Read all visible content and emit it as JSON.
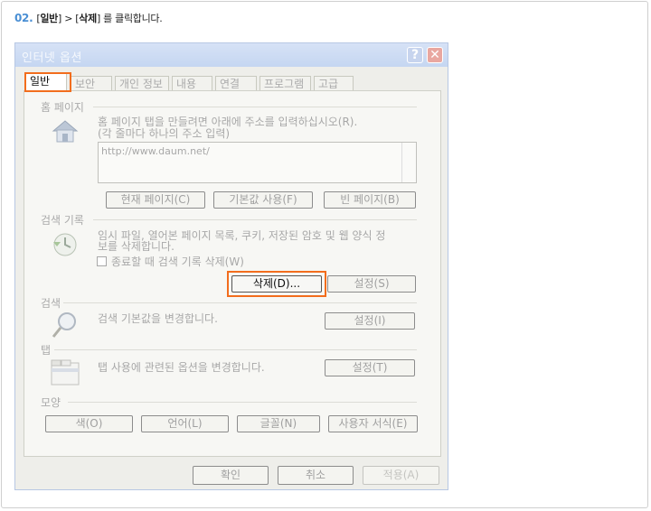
{
  "step": {
    "number": "02.",
    "text_pre": "[",
    "bold1": "일반",
    "text_mid": "] > [",
    "bold2": "삭제",
    "text_post": "] 를 클릭합니다."
  },
  "dialog": {
    "title": "인터넷 옵션",
    "help_glyph": "?",
    "close_glyph": "✕",
    "tabs": [
      "일반",
      "보안",
      "개인 정보",
      "내용",
      "연결",
      "프로그램",
      "고급"
    ],
    "home": {
      "header": "홈 페이지",
      "desc1": "홈 페이지 탭을 만들려면 아래에 주소를 입력하십시오(R).",
      "desc2": "(각 줄마다 하나의 주소 입력)",
      "url": "http://www.daum.net/",
      "btn_current": "현재 페이지(C)",
      "btn_default": "기본값 사용(F)",
      "btn_blank": "빈 페이지(B)"
    },
    "history": {
      "header": "검색 기록",
      "desc1": "임시 파일, 열어본 페이지 목록, 쿠키, 저장된 암호 및 웹 양식 정",
      "desc2": "보를 삭제합니다.",
      "checkbox_label": "종료할 때 검색 기록 삭제(W)",
      "btn_delete": "삭제(D)...",
      "btn_settings": "설정(S)"
    },
    "search": {
      "header": "검색",
      "desc": "검색 기본값을 변경합니다.",
      "btn_settings": "설정(I)"
    },
    "tabsec": {
      "header": "탭",
      "desc": "탭 사용에 관련된 옵션을 변경합니다.",
      "btn_settings": "설정(T)"
    },
    "appearance": {
      "header": "모양",
      "btn_color": "색(O)",
      "btn_lang": "언어(L)",
      "btn_font": "글꼴(N)",
      "btn_access": "사용자 서식(E)"
    },
    "footer": {
      "ok": "확인",
      "cancel": "취소",
      "apply": "적용(A)"
    }
  },
  "colors": {
    "highlight": "#f26d1d",
    "step_number": "#4a8fd4"
  }
}
